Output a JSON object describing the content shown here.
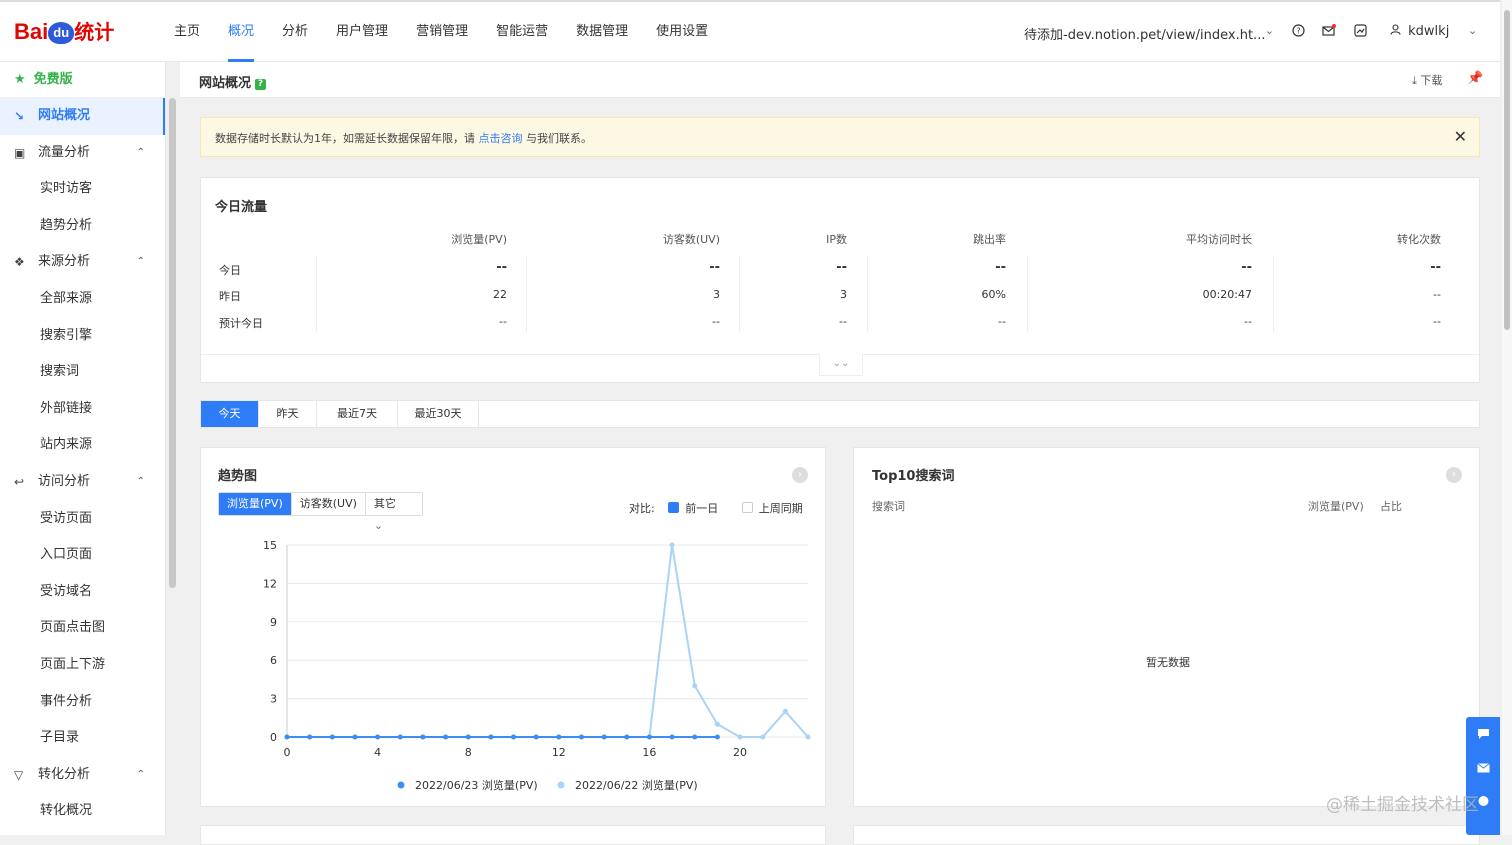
{
  "brand": {
    "bai": "Bai",
    "du": "du",
    "tj": "统计"
  },
  "nav": {
    "items": [
      "主页",
      "概况",
      "分析",
      "用户管理",
      "营销管理",
      "智能运营",
      "数据管理",
      "使用设置"
    ],
    "active": 1
  },
  "site_selector": "待添加-dev.notion.pet/view/index.ht...",
  "user": "kdwlkj",
  "sidebar": {
    "free_label": "免费版",
    "items": [
      {
        "label": "网站概况",
        "type": "group",
        "icon": "line-chart-icon",
        "active": true
      },
      {
        "label": "流量分析",
        "type": "group",
        "icon": "image-icon",
        "expanded": true
      },
      {
        "label": "实时访客",
        "type": "sub"
      },
      {
        "label": "趋势分析",
        "type": "sub"
      },
      {
        "label": "来源分析",
        "type": "group",
        "icon": "signal-icon",
        "expanded": true
      },
      {
        "label": "全部来源",
        "type": "sub"
      },
      {
        "label": "搜索引擎",
        "type": "sub"
      },
      {
        "label": "搜索词",
        "type": "sub"
      },
      {
        "label": "外部链接",
        "type": "sub"
      },
      {
        "label": "站内来源",
        "type": "sub"
      },
      {
        "label": "访问分析",
        "type": "group",
        "icon": "login-icon",
        "expanded": true
      },
      {
        "label": "受访页面",
        "type": "sub"
      },
      {
        "label": "入口页面",
        "type": "sub"
      },
      {
        "label": "受访域名",
        "type": "sub"
      },
      {
        "label": "页面点击图",
        "type": "sub"
      },
      {
        "label": "页面上下游",
        "type": "sub"
      },
      {
        "label": "事件分析",
        "type": "sub"
      },
      {
        "label": "子目录",
        "type": "sub"
      },
      {
        "label": "转化分析",
        "type": "group",
        "icon": "funnel-icon",
        "expanded": true
      },
      {
        "label": "转化概况",
        "type": "sub"
      }
    ]
  },
  "header": {
    "title": "网站概况",
    "download": "下载"
  },
  "notice": {
    "before": "数据存储时长默认为1年，如需延长数据保留年限，请 ",
    "link": "点击咨询",
    "after": " 与我们联系。"
  },
  "traffic": {
    "title": "今日流量",
    "columns": [
      "浏览量(PV)",
      "访客数(UV)",
      "IP数",
      "跳出率",
      "平均访问时长",
      "转化次数"
    ],
    "rows": [
      {
        "label": "今日",
        "values": [
          "--",
          "--",
          "--",
          "--",
          "--",
          "--"
        ]
      },
      {
        "label": "昨日",
        "values": [
          "22",
          "3",
          "3",
          "60%",
          "00:20:47",
          "--"
        ]
      },
      {
        "label": "预计今日",
        "values": [
          "--",
          "--",
          "--",
          "--",
          "--",
          "--"
        ]
      }
    ]
  },
  "period_tabs": {
    "items": [
      "今天",
      "昨天",
      "最近7天",
      "最近30天"
    ],
    "active": 0
  },
  "trend": {
    "title": "趋势图",
    "metrics": [
      "浏览量(PV)",
      "访客数(UV)",
      "其它"
    ],
    "active_metric": 0,
    "compare_label": "对比:",
    "compare_options": [
      {
        "label": "前一日",
        "checked": true
      },
      {
        "label": "上周同期",
        "checked": false
      }
    ]
  },
  "chart_data": {
    "type": "line",
    "x": [
      0,
      1,
      2,
      3,
      4,
      5,
      6,
      7,
      8,
      9,
      10,
      11,
      12,
      13,
      14,
      15,
      16,
      17,
      18,
      19,
      20,
      21,
      22,
      23
    ],
    "xticks": [
      0,
      4,
      8,
      12,
      16,
      20
    ],
    "yticks": [
      0,
      3,
      6,
      9,
      12,
      15
    ],
    "ylim": [
      0,
      15
    ],
    "grid": true,
    "legend": "bottom",
    "series": [
      {
        "name": "2022/06/23 浏览量(PV)",
        "color": "#3b8ff0",
        "values": [
          0,
          0,
          0,
          0,
          0,
          0,
          0,
          0,
          0,
          0,
          0,
          0,
          0,
          0,
          0,
          0,
          0,
          0,
          0,
          0,
          null,
          null,
          null,
          null
        ]
      },
      {
        "name": "2022/06/22 浏览量(PV)",
        "color": "#a9d3f7",
        "values": [
          0,
          0,
          0,
          0,
          0,
          0,
          0,
          0,
          0,
          0,
          0,
          0,
          0,
          0,
          0,
          0,
          0,
          15,
          4,
          1,
          0,
          0,
          2,
          0
        ]
      }
    ]
  },
  "top10": {
    "title": "Top10搜索词",
    "columns": [
      "搜索词",
      "浏览量(PV)",
      "占比"
    ],
    "empty": "暂无数据"
  },
  "watermark": "@稀土掘金技术社区"
}
